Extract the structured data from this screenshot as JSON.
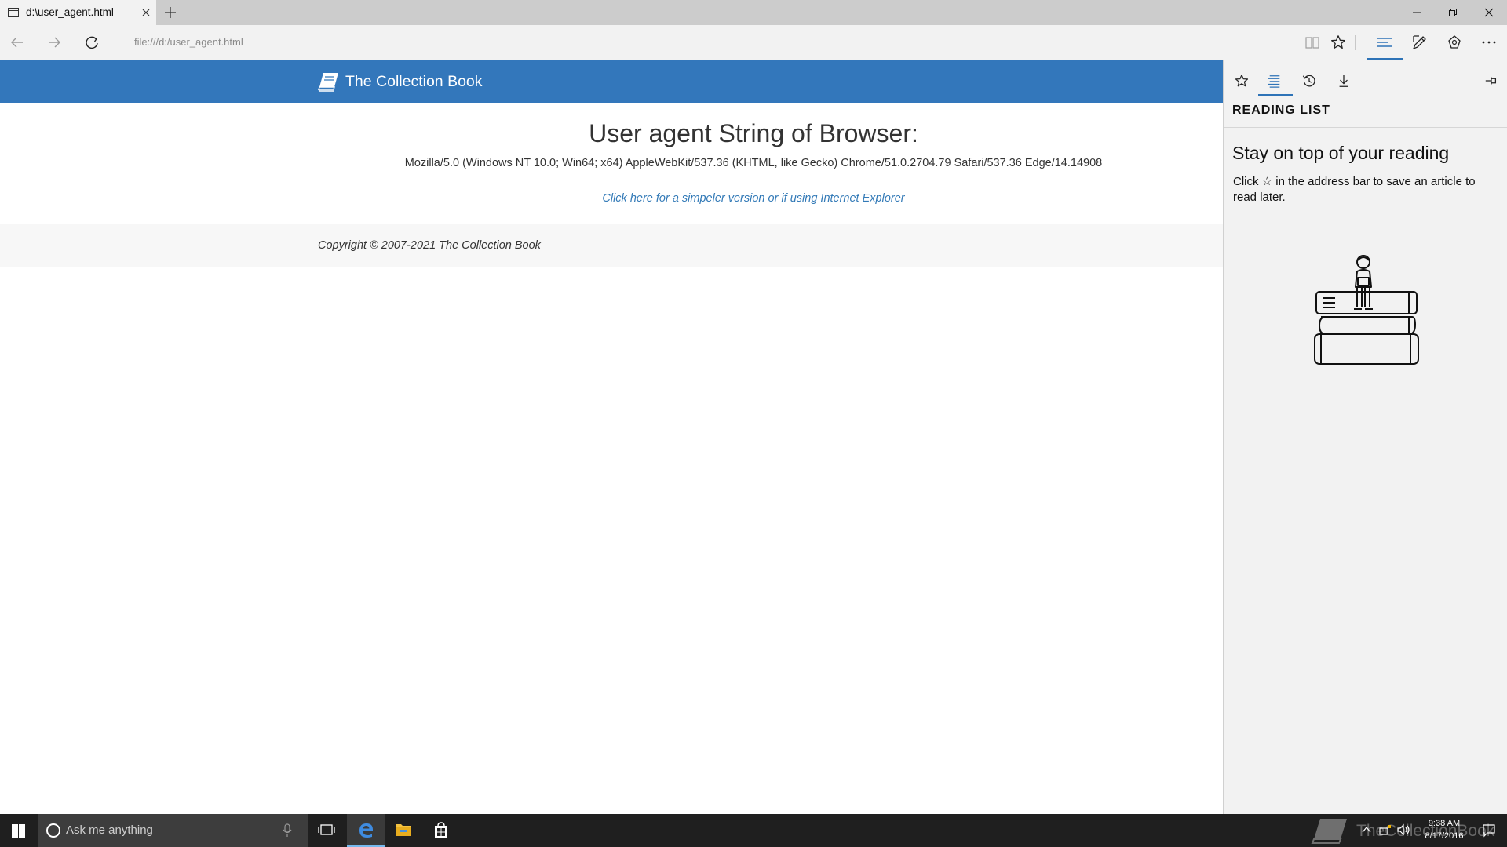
{
  "browser": {
    "tab": {
      "title": "d:\\user_agent.html"
    },
    "address": {
      "url": "file:///d:/user_agent.html"
    },
    "buttons": {
      "back": "back-arrow-icon",
      "forward": "forward-arrow-icon",
      "refresh": "refresh-icon",
      "reading_view": "book-icon",
      "favorite": "star-icon",
      "hub": "hub-lines-icon",
      "web_note": "pen-icon",
      "share": "share-icon",
      "more": "ellipsis-icon"
    }
  },
  "page": {
    "brand": "The Collection Book",
    "heading": "User agent String of Browser:",
    "user_agent": "Mozilla/5.0 (Windows NT 10.0; Win64; x64) AppleWebKit/537.36 (KHTML, like Gecko) Chrome/51.0.2704.79 Safari/537.36 Edge/14.14908",
    "link": "Click here for a simpeler version or if using Internet Explorer",
    "copyright": "Copyright © 2007-2021 The Collection Book",
    "header_color": "#3377bb",
    "link_color": "#337ab7"
  },
  "hub": {
    "tabs": [
      "favorites",
      "reading-list",
      "history",
      "downloads"
    ],
    "active_tab": "reading-list",
    "title": "READING LIST",
    "heading": "Stay on top of your reading",
    "description": "Click ☆ in the address bar to save an article to read later."
  },
  "taskbar": {
    "search_placeholder": "Ask me anything",
    "watermark": "TheCollectionBook",
    "time": "9:38 AM",
    "date": "8/17/2016",
    "accent": "#76b9ed"
  }
}
